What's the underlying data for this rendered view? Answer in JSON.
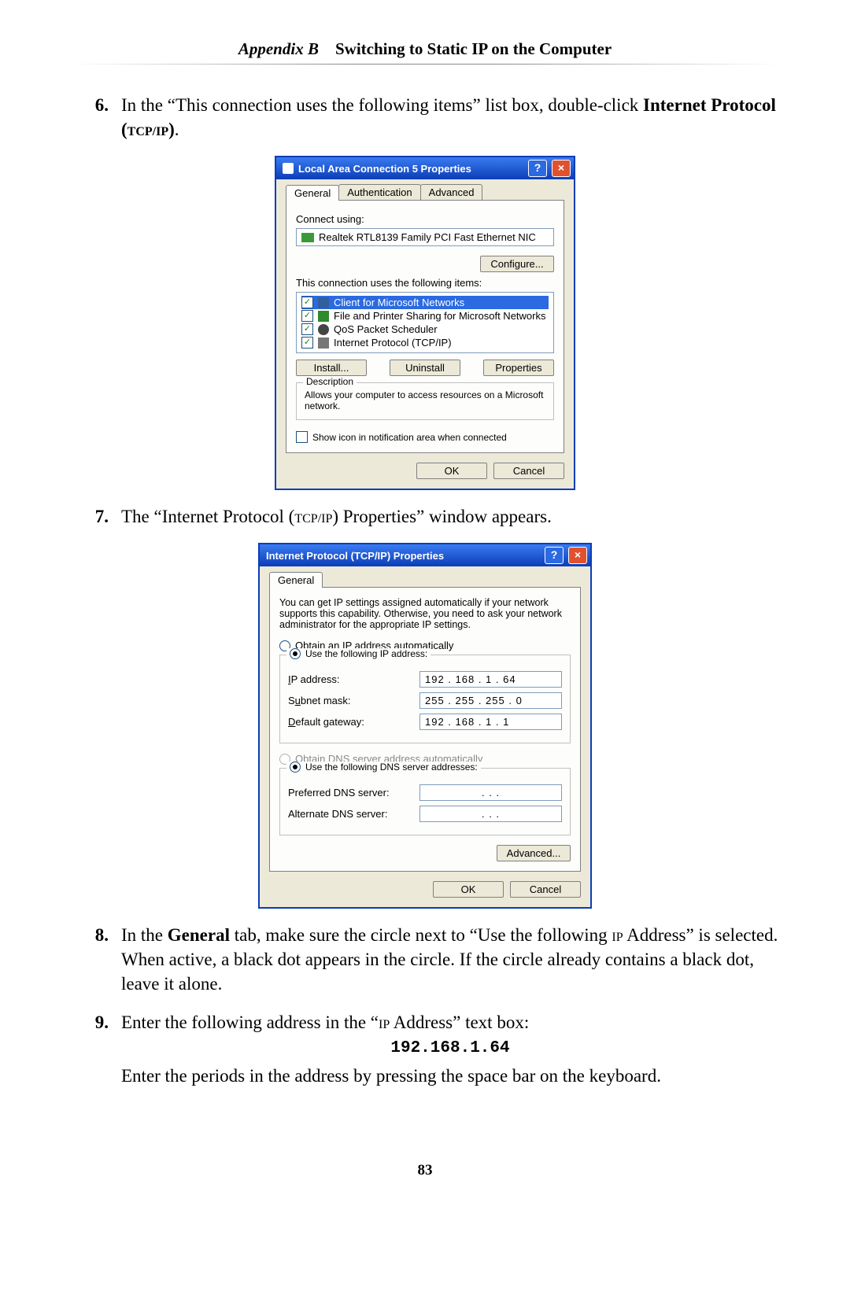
{
  "header": {
    "appendix": "Appendix B",
    "title": "Switching to Static IP on the Computer"
  },
  "page_number": "83",
  "steps": {
    "s6": {
      "num": "6.",
      "text_prefix": "In the “This connection uses the following items” list box, double-click ",
      "bold1": "Internet Protocol (",
      "sc1": "TCP/IP",
      "bold2": ")"
    },
    "s7": {
      "num": "7.",
      "text": "The “Internet Protocol (",
      "sc": "TCP/IP",
      "text2": ") Properties” window appears."
    },
    "s8": {
      "num": "8.",
      "p1": "In the ",
      "b1": "General",
      "p2": " tab, make sure the circle next to “Use the following ",
      "sc": "IP",
      "p3": " Address” is selected. When active, a black dot appears in the circle. If the circle already contains a black dot, leave it alone."
    },
    "s9": {
      "num": "9.",
      "p1": "Enter the following address in the “",
      "sc1": "IP",
      "p2": " Address” text box:",
      "code": "192.168.1.64",
      "p3": "Enter the periods in the address by pressing the space bar on the keyboard."
    }
  },
  "dlg1": {
    "title": "Local Area Connection 5 Properties",
    "tabs": {
      "general": "General",
      "auth": "Authentication",
      "adv": "Advanced"
    },
    "connect_label": "Connect using:",
    "nic": "Realtek RTL8139 Family PCI Fast Ethernet NIC",
    "configure": "Configure...",
    "items_label": "This connection uses the following items:",
    "items": [
      "Client for Microsoft Networks",
      "File and Printer Sharing for Microsoft Networks",
      "QoS Packet Scheduler",
      "Internet Protocol (TCP/IP)"
    ],
    "install": "Install...",
    "uninstall": "Uninstall",
    "properties": "Properties",
    "desc_title": "Description",
    "desc_text": "Allows your computer to access resources on a Microsoft network.",
    "show_icon": "Show icon in notification area when connected",
    "ok": "OK",
    "cancel": "Cancel"
  },
  "dlg2": {
    "title": "Internet Protocol (TCP/IP) Properties",
    "tab": "General",
    "intro": "You can get IP settings assigned automatically if your network supports this capability. Otherwise, you need to ask your network administrator for the appropriate IP settings.",
    "r_auto_ip": "Obtain an IP address automatically",
    "r_use_ip": "Use the following IP address:",
    "ip_label": "IP address:",
    "subnet_label": "Subnet mask:",
    "gateway_label": "Default gateway:",
    "ip_value": "192 . 168 .   1  .  64",
    "subnet_value": "255 . 255 . 255 .   0",
    "gateway_value": "192 . 168 .   1  .   1",
    "r_auto_dns": "Obtain DNS server address automatically",
    "r_use_dns": "Use the following DNS server addresses:",
    "pref_dns_label": "Preferred DNS server:",
    "alt_dns_label": "Alternate DNS server:",
    "dns_blank": ".       .       .",
    "advanced": "Advanced...",
    "ok": "OK",
    "cancel": "Cancel"
  }
}
